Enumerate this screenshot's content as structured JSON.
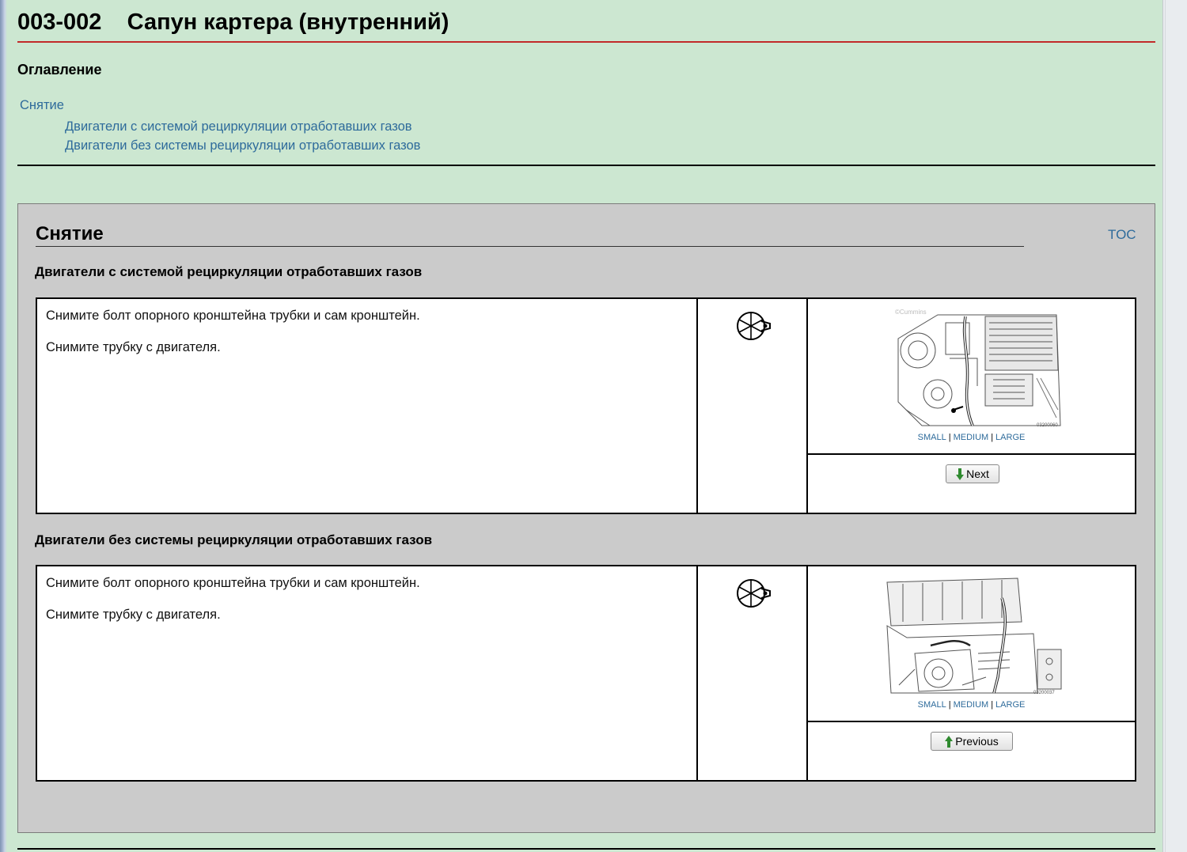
{
  "header": {
    "title": "003-002    Сапун картера (внутренний)"
  },
  "toc": {
    "heading": "Оглавление",
    "items": [
      {
        "label": "Снятие"
      },
      {
        "label": "Двигатели с системой рециркуляции отработавших газов"
      },
      {
        "label": "Двигатели без системы рециркуляции отработавших газов"
      }
    ]
  },
  "section": {
    "title": "Снятие",
    "toc_link": "TOC",
    "subsections": [
      {
        "title": "Двигатели с системой рециркуляции отработавших газов",
        "steps": [
          "Снимите болт опорного кронштейна трубки и сам кронштейн.",
          "Снимите трубку с двигателя."
        ],
        "image_caption": "03200060",
        "image_watermark": "©Cummins",
        "size_links": [
          "SMALL",
          "MEDIUM",
          "LARGE"
        ],
        "nav_button": {
          "label": "Next",
          "icon": "arrow-down-icon"
        }
      },
      {
        "title": "Двигатели без системы рециркуляции отработавших газов",
        "steps": [
          "Снимите болт опорного кронштейна трубки и сам кронштейн.",
          "Снимите трубку с двигателя."
        ],
        "image_caption": "03200037",
        "size_links": [
          "SMALL",
          "MEDIUM",
          "LARGE"
        ],
        "nav_button": {
          "label": "Previous",
          "icon": "arrow-up-icon"
        }
      }
    ]
  },
  "colors": {
    "background": "#cce7d1",
    "panel": "#cbcbcb",
    "title_rule": "#c22a2a",
    "link": "#2e6b9b"
  }
}
